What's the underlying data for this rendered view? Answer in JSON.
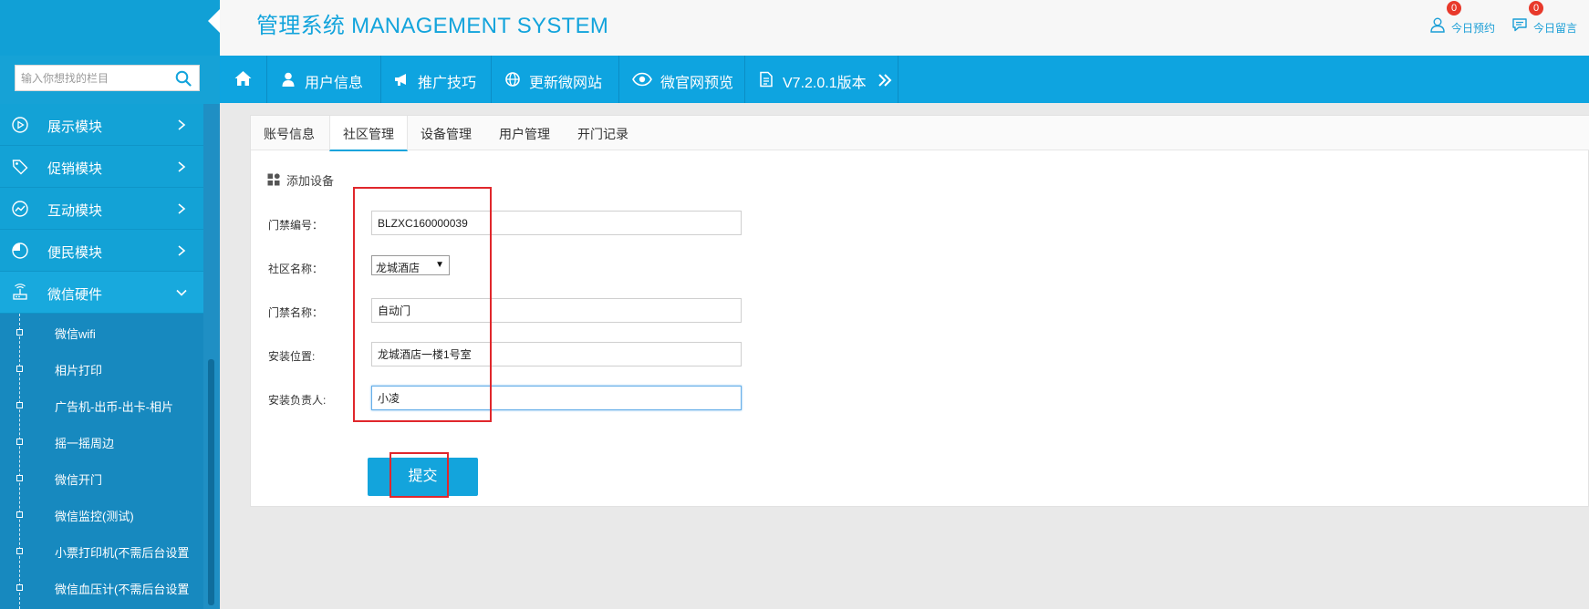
{
  "header": {
    "title": "管理系统 MANAGEMENT SYSTEM",
    "links": [
      {
        "label": "今日预约",
        "badge": "0",
        "icon": "user-icon"
      },
      {
        "label": "今日留言",
        "badge": "0",
        "icon": "comment-icon"
      }
    ]
  },
  "sidebar": {
    "search_placeholder": "输入你想找的栏目",
    "menu": [
      {
        "label": "展示模块",
        "icon": "play-circle-icon"
      },
      {
        "label": "促销模块",
        "icon": "tag-icon"
      },
      {
        "label": "互动模块",
        "icon": "chart-line-icon"
      },
      {
        "label": "便民模块",
        "icon": "pie-chart-icon"
      },
      {
        "label": "微信硬件",
        "icon": "router-icon",
        "expanded": true
      }
    ],
    "submenu": [
      {
        "label": "微信wifi"
      },
      {
        "label": "相片打印"
      },
      {
        "label": "广告机-出币-出卡-相片"
      },
      {
        "label": "摇一摇周边"
      },
      {
        "label": "微信开门"
      },
      {
        "label": "微信监控(测试)"
      },
      {
        "label": "小票打印机(不需后台设置"
      },
      {
        "label": "微信血压计(不需后台设置"
      }
    ]
  },
  "topnav": [
    {
      "label": "",
      "icon": "home-icon"
    },
    {
      "label": "用户信息",
      "icon": "user-icon"
    },
    {
      "label": "推广技巧",
      "icon": "bullhorn-icon"
    },
    {
      "label": "更新微网站",
      "icon": "globe-icon"
    },
    {
      "label": "微官网预览",
      "icon": "eye-icon"
    },
    {
      "label": "V7.2.0.1版本",
      "icon": "document-icon"
    }
  ],
  "tabs": [
    {
      "label": "账号信息",
      "active": false
    },
    {
      "label": "社区管理",
      "active": true
    },
    {
      "label": "设备管理",
      "active": false
    },
    {
      "label": "用户管理",
      "active": false
    },
    {
      "label": "开门记录",
      "active": false
    }
  ],
  "form": {
    "section_title": "添加设备",
    "door_id_label": "门禁编号：",
    "door_id_value": "BLZXC160000039",
    "community_label": "社区名称：",
    "community_value": "龙城酒店",
    "door_name_label": "门禁名称：",
    "door_name_value": "自动门",
    "location_label": "安装位置:",
    "location_value": "龙城酒店一楼1号室",
    "person_label": "安装负责人:",
    "person_value": "小凌",
    "submit_label": "提交"
  },
  "colors": {
    "accent": "#13a4dc",
    "sidebar": "#16a2d6",
    "annotation": "#e0272c",
    "badge": "#e8392b"
  }
}
